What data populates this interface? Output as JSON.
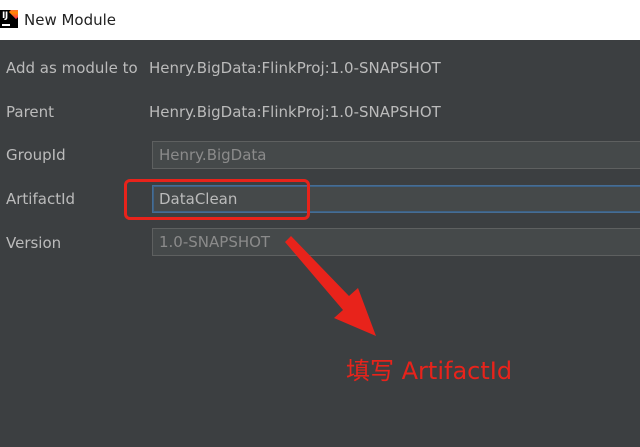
{
  "window": {
    "title": "New Module"
  },
  "form": {
    "add_as_module_to": {
      "label": "Add as module to",
      "value": "Henry.BigData:FlinkProj:1.0-SNAPSHOT"
    },
    "parent": {
      "label": "Parent",
      "value": "Henry.BigData:FlinkProj:1.0-SNAPSHOT"
    },
    "group_id": {
      "label": "GroupId",
      "value": "Henry.BigData"
    },
    "artifact_id": {
      "label": "ArtifactId",
      "value": "DataClean"
    },
    "version": {
      "label": "Version",
      "value": "1.0-SNAPSHOT"
    }
  },
  "annotation": {
    "text": "填写 ArtifactId",
    "color": "#e8231b"
  },
  "colors": {
    "background": "#3c3f41",
    "text": "#bbbbbb",
    "focus_border": "#466d94"
  }
}
